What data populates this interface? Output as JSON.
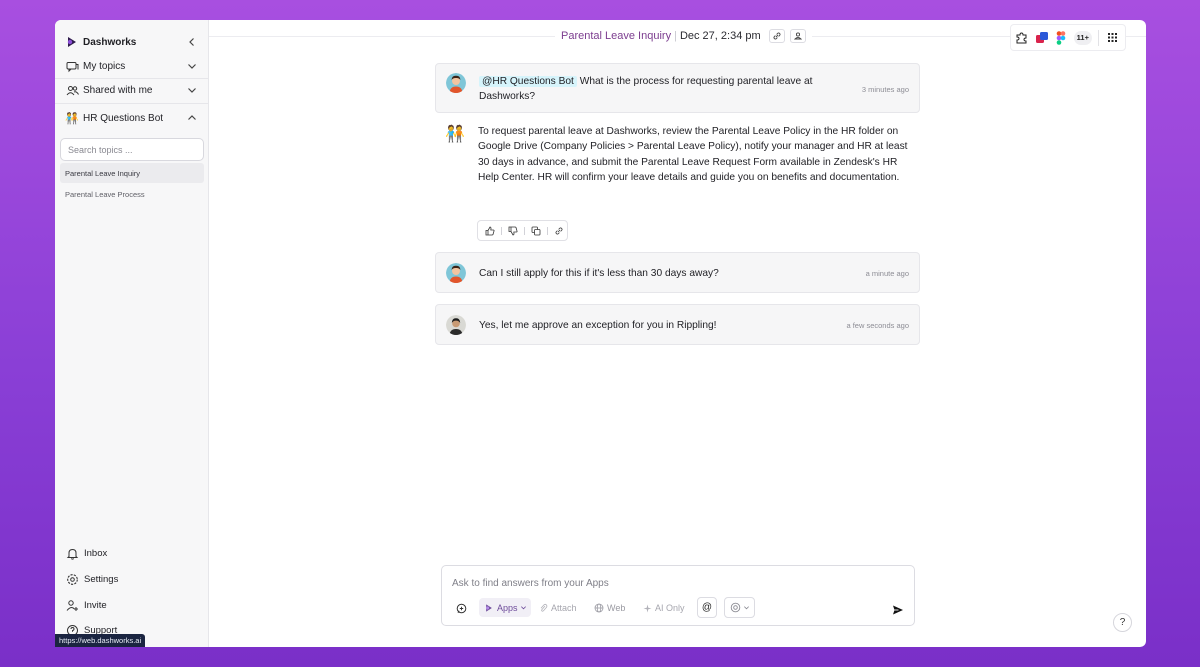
{
  "sidebar": {
    "workspace_name": "Dashworks",
    "my_topics_label": "My topics",
    "shared_label": "Shared with me",
    "bot_label": "HR Questions Bot",
    "search_placeholder": "Search topics ...",
    "topics": [
      "Parental Leave Inquiry",
      "Parental Leave Process"
    ],
    "bottom_items": [
      "Inbox",
      "Settings",
      "Invite",
      "Support"
    ]
  },
  "status_url": "https://web.dashworks.ai",
  "header": {
    "topic_title": "Parental Leave Inquiry",
    "separator": "|",
    "date": "Dec 27, 2:34 pm",
    "more_apps": "11+"
  },
  "messages": [
    {
      "mention": "@HR Questions Bot",
      "text": "What is the process for requesting parental leave at Dashworks?",
      "time": "3 minutes ago"
    },
    {
      "bot_answer": "To request parental leave at Dashworks, review the Parental Leave Policy in the HR folder on Google Drive (Company Policies > Parental Leave Policy), notify your manager and HR at least 30 days in advance, and submit the Parental Leave Request Form available in Zendesk's HR Help Center. HR will confirm your leave details and guide you on benefits and documentation."
    },
    {
      "text": "Can I still apply for this if it's less than 30 days away?",
      "time": "a minute ago"
    },
    {
      "text": "Yes, let me approve an exception for you in Rippling!",
      "time": "a few seconds ago"
    }
  ],
  "composer": {
    "placeholder": "Ask to find answers from your Apps",
    "apps_label": "Apps",
    "attach_label": "Attach",
    "web_label": "Web",
    "ai_only_label": "AI Only",
    "mention_symbol": "@"
  },
  "help_label": "?",
  "colors": {
    "accent_purple": "#7c3d8f",
    "mention_bg": "#d6f4fb",
    "background_gradient_top": "#a84fe0"
  }
}
